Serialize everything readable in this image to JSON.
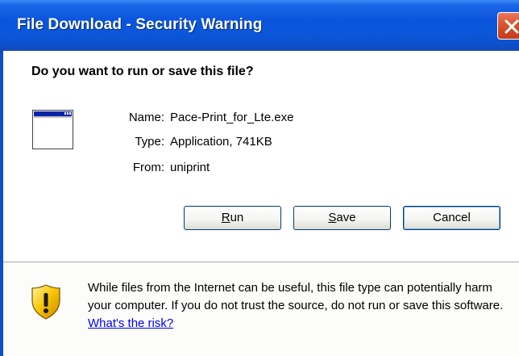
{
  "window": {
    "title": "File Download - Security Warning"
  },
  "dialog": {
    "question": "Do you want to run or save this file?",
    "icon": "application-window-icon",
    "fields": {
      "name_label": "Name:",
      "name_value": "Pace-Print_for_Lte.exe",
      "type_label": "Type:",
      "type_value": "Application, 741KB",
      "from_label": "From:",
      "from_value": "uniprint"
    },
    "buttons": {
      "run_mnemonic": "R",
      "run_rest": "un",
      "save_mnemonic": "S",
      "save_rest": "ave",
      "cancel": "Cancel"
    }
  },
  "warning": {
    "icon": "security-shield-icon",
    "text": "While files from the Internet can be useful, this file type can potentially harm your computer. If you do not trust the source, do not run or save this software.",
    "link": "What's the risk?"
  },
  "colors": {
    "titlebar": "#0a55dc",
    "close": "#d8542f",
    "link": "#0000ff"
  }
}
